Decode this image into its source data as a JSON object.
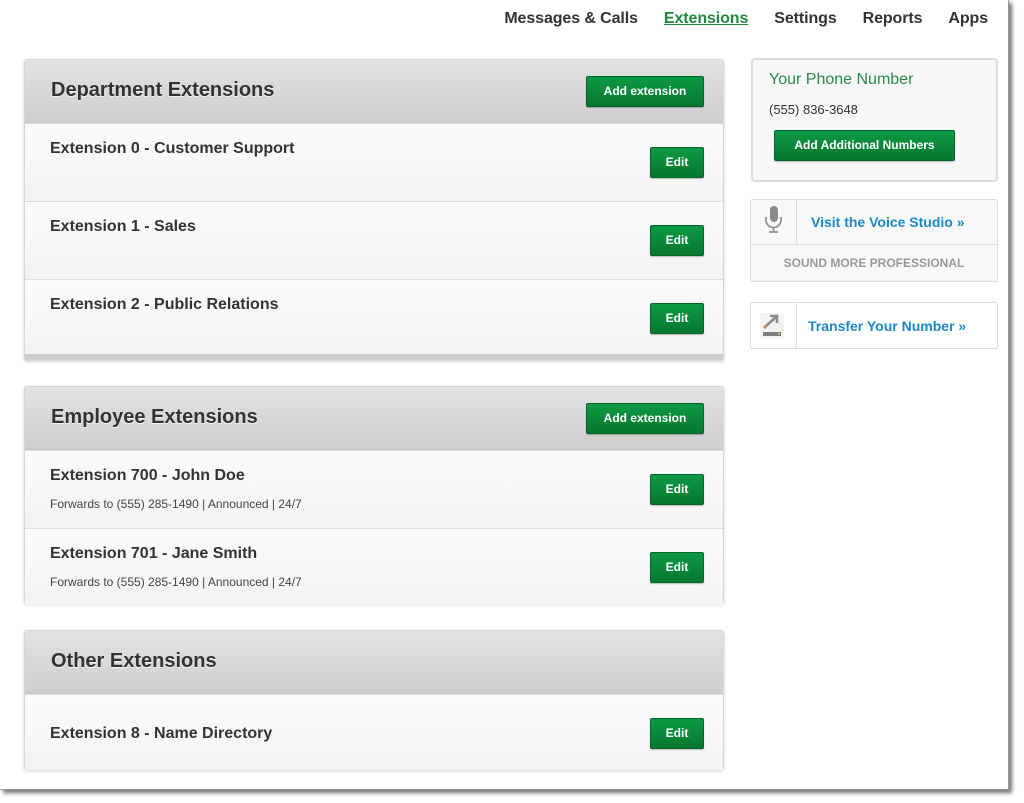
{
  "nav": {
    "items": [
      {
        "label": "Messages & Calls",
        "active": false
      },
      {
        "label": "Extensions",
        "active": true
      },
      {
        "label": "Settings",
        "active": false
      },
      {
        "label": "Reports",
        "active": false
      },
      {
        "label": "Apps",
        "active": false
      }
    ]
  },
  "sections": [
    {
      "title": "Department Extensions",
      "add_label": "Add extension",
      "rows": [
        {
          "title": "Extension 0 - Customer Support",
          "subtitle": "",
          "edit_label": "Edit"
        },
        {
          "title": "Extension 1 - Sales",
          "subtitle": "",
          "edit_label": "Edit"
        },
        {
          "title": "Extension 2 - Public Relations",
          "subtitle": "",
          "edit_label": "Edit"
        }
      ]
    },
    {
      "title": "Employee Extensions",
      "add_label": "Add extension",
      "rows": [
        {
          "title": "Extension 700 - John Doe",
          "subtitle": "Forwards to (555) 285-1490 | Announced | 24/7",
          "edit_label": "Edit"
        },
        {
          "title": "Extension 701 - Jane Smith",
          "subtitle": "Forwards to (555) 285-1490 | Announced | 24/7",
          "edit_label": "Edit"
        }
      ]
    },
    {
      "title": "Other Extensions",
      "rows": [
        {
          "title": "Extension 8 - Name Directory",
          "subtitle": "",
          "edit_label": "Edit"
        }
      ]
    }
  ],
  "sidebar": {
    "phone": {
      "title": "Your Phone Number",
      "number": "(555) 836-3648",
      "button_label": "Add Additional Numbers"
    },
    "voice_studio": {
      "icon": "microphone-icon",
      "link_label": "Visit the Voice Studio »",
      "tagline": "SOUND MORE PROFESSIONAL"
    },
    "transfer": {
      "icon": "transfer-arrow-icon",
      "link_label": "Transfer Your Number »"
    }
  },
  "colors": {
    "brand_green": "#0a8a3a",
    "active_nav": "#1e8a3e",
    "link_blue": "#1a8ac8",
    "phone_title_green": "#2b8a4b"
  }
}
